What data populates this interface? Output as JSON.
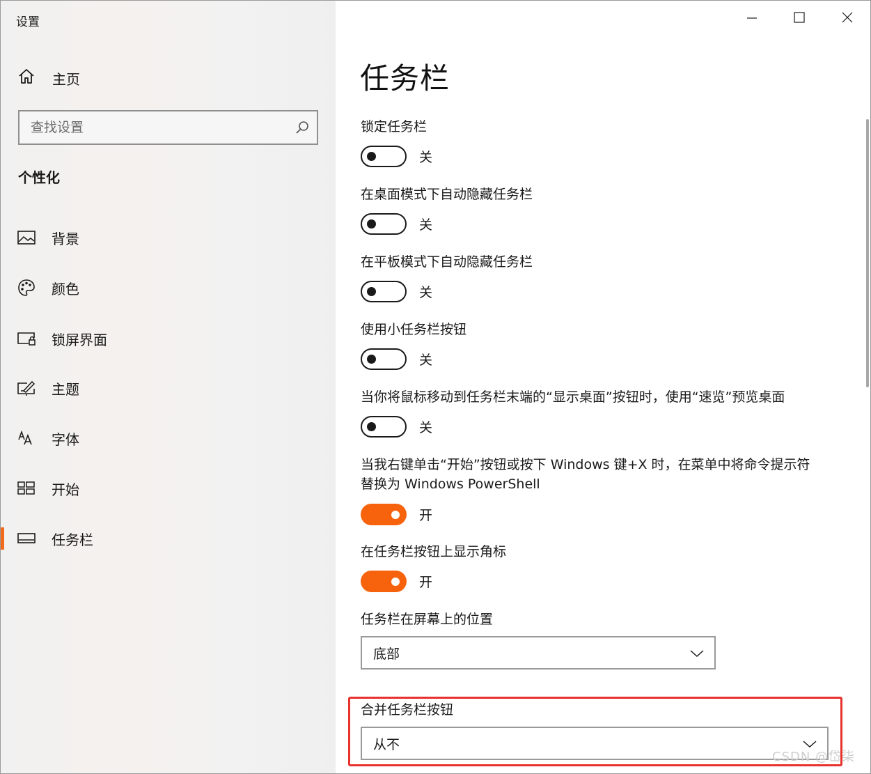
{
  "app": {
    "title": "设置"
  },
  "window_controls": {
    "minimize": "minimize-icon",
    "maximize": "maximize-icon",
    "close": "close-icon"
  },
  "sidebar": {
    "home_label": "主页",
    "search_placeholder": "查找设置",
    "section_title": "个性化",
    "items": [
      {
        "label": "背景",
        "icon": "picture-icon"
      },
      {
        "label": "颜色",
        "icon": "palette-icon"
      },
      {
        "label": "锁屏界面",
        "icon": "lock-screen-icon"
      },
      {
        "label": "主题",
        "icon": "theme-brush-icon"
      },
      {
        "label": "字体",
        "icon": "font-icon"
      },
      {
        "label": "开始",
        "icon": "start-tiles-icon"
      },
      {
        "label": "任务栏",
        "icon": "taskbar-icon",
        "active": true
      }
    ]
  },
  "main": {
    "title": "任务栏",
    "toggles": [
      {
        "label": "锁定任务栏",
        "state": "关",
        "on": false
      },
      {
        "label": "在桌面模式下自动隐藏任务栏",
        "state": "关",
        "on": false
      },
      {
        "label": "在平板模式下自动隐藏任务栏",
        "state": "关",
        "on": false
      },
      {
        "label": "使用小任务栏按钮",
        "state": "关",
        "on": false
      },
      {
        "label": "当你将鼠标移动到任务栏末端的“显示桌面”按钮时，使用“速览”预览桌面",
        "state": "关",
        "on": false
      },
      {
        "label": "当我右键单击“开始”按钮或按下 Windows 键+X 时，在菜单中将命令提示符替换为 Windows PowerShell",
        "state": "开",
        "on": true
      },
      {
        "label": "在任务栏按钮上显示角标",
        "state": "开",
        "on": true
      }
    ],
    "position": {
      "label": "任务栏在屏幕上的位置",
      "value": "底部"
    },
    "combine": {
      "label": "合并任务栏按钮",
      "value": "从不"
    }
  },
  "accent_color": "#f7630c",
  "highlight_color": "#e8322d",
  "watermark": "CSDN @岱柒"
}
